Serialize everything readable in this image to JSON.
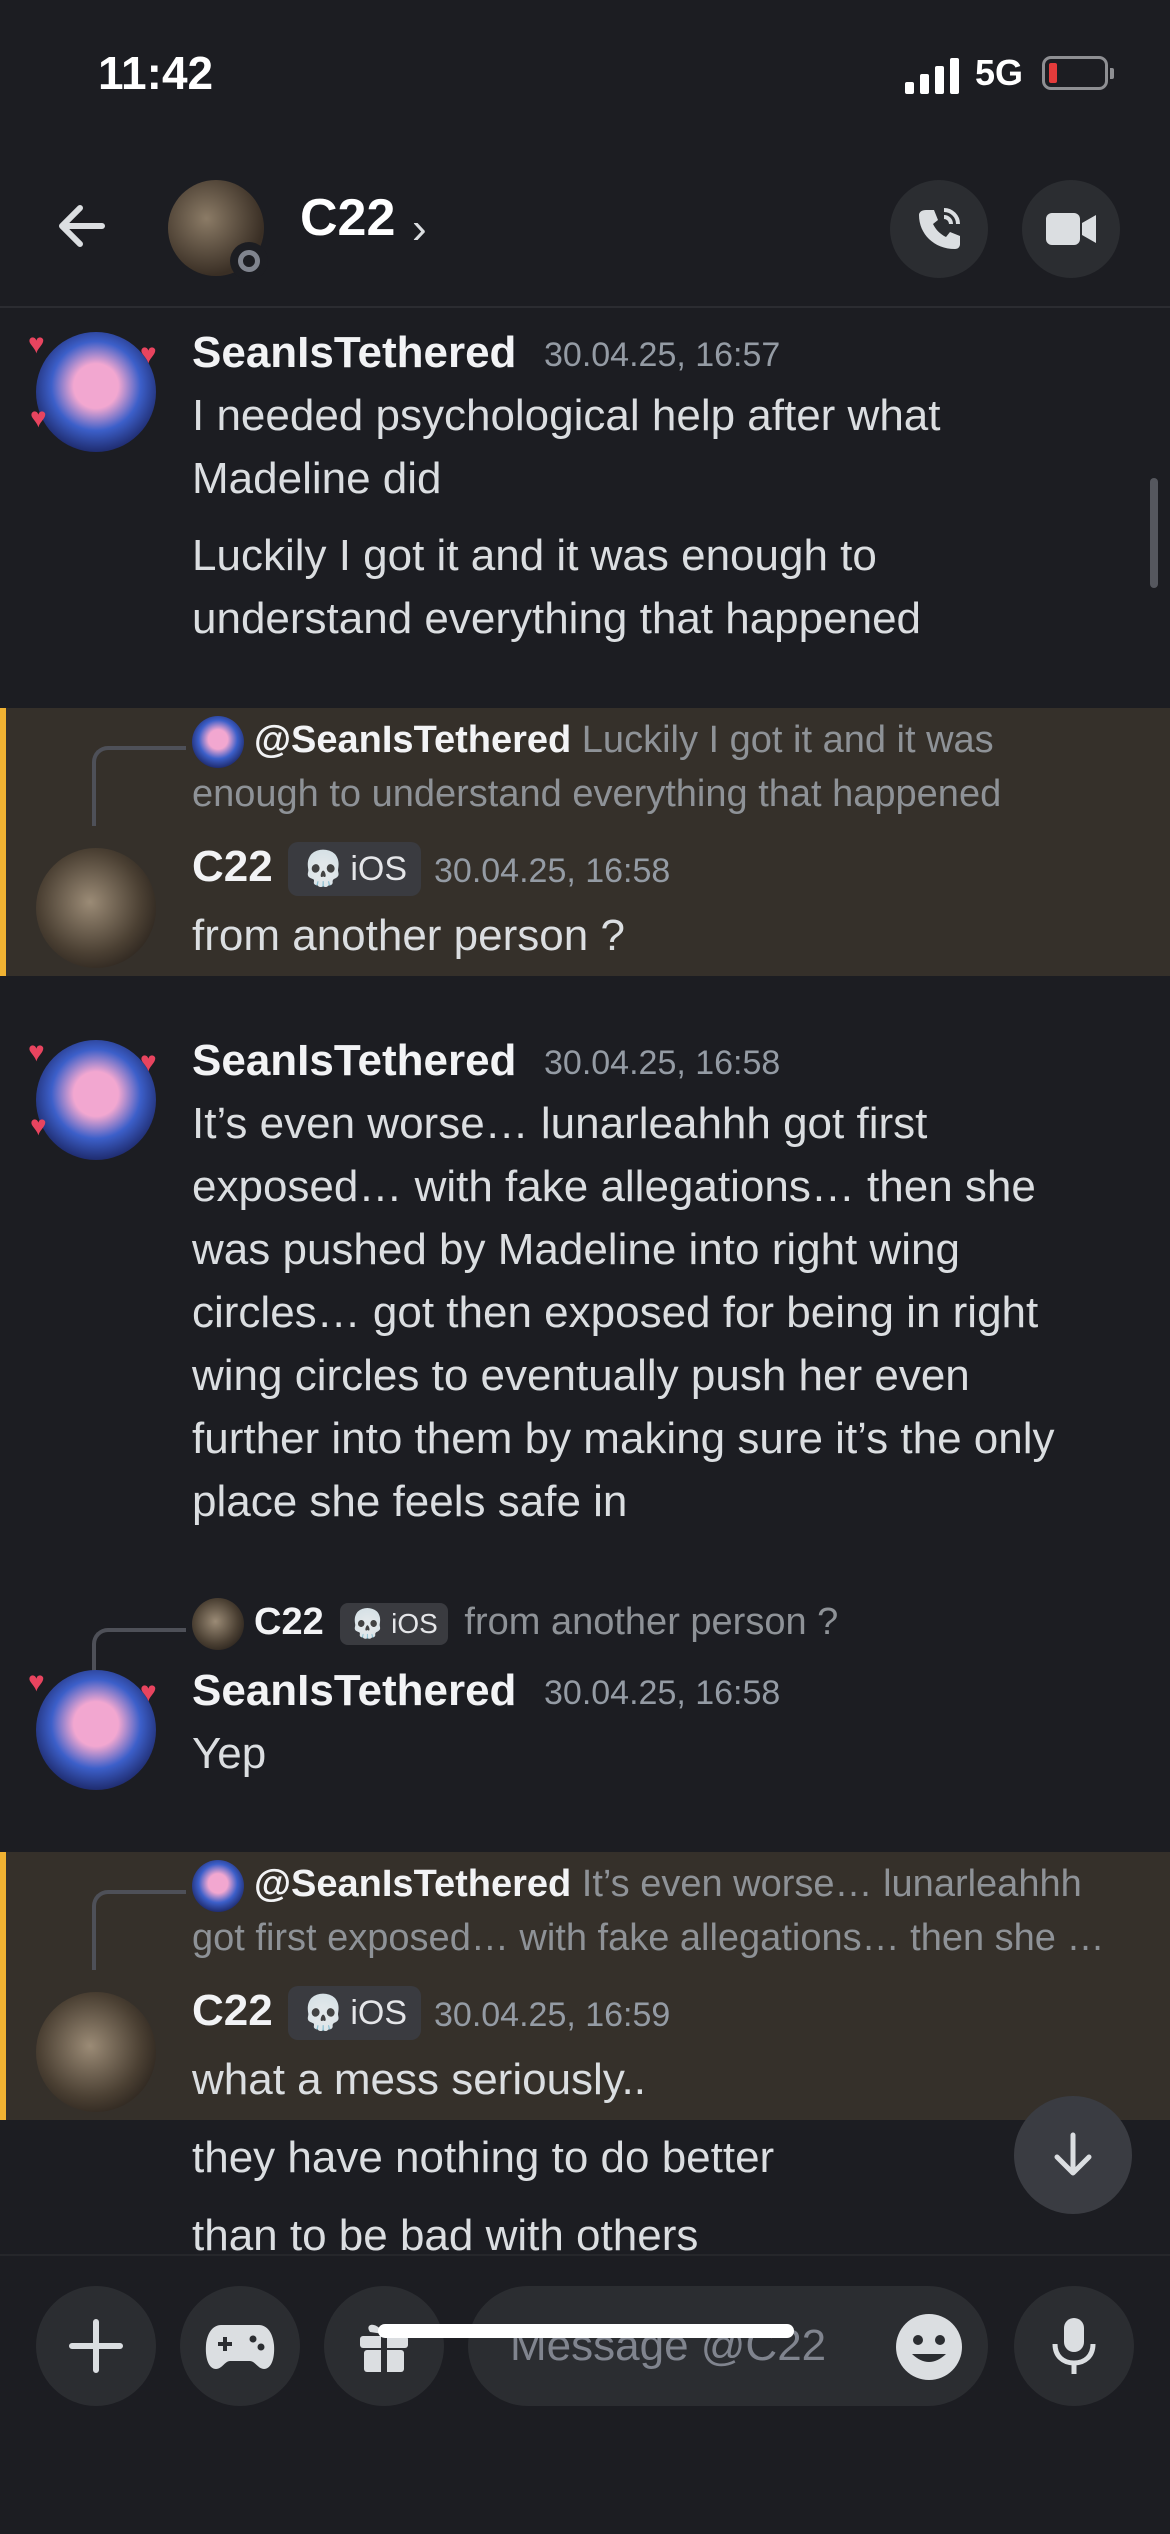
{
  "status_bar": {
    "time": "11:42",
    "network": "5G"
  },
  "header": {
    "channel_name": "C22",
    "chevron": "›"
  },
  "messages": [
    {
      "author": "SeanIsTethered",
      "timestamp": "30.04.25, 16:57",
      "lines": [
        "I needed psychological help after what",
        "Madeline did"
      ],
      "lines2": [
        "Luckily I got it and it was enough to",
        "understand everything that happened"
      ]
    },
    {
      "reply_author": "@SeanIsTethered",
      "reply_text_1": "Luckily I got it and it was",
      "reply_text_2": "enough to understand everything that happened",
      "author": "C22",
      "tag": "iOS",
      "timestamp": "30.04.25, 16:58",
      "text": "from another person ?"
    },
    {
      "author": "SeanIsTethered",
      "timestamp": "30.04.25, 16:58",
      "lines": [
        "It’s even worse… lunarleahhh got first",
        "exposed… with fake allegations… then she",
        "was pushed by Madeline into right wing",
        "circles… got then exposed for being in right",
        "wing circles to eventually push her even",
        "further into them by making sure it’s the only",
        "place she feels safe in"
      ]
    },
    {
      "reply_author": "C22",
      "reply_tag": "iOS",
      "reply_text": "from another person ?",
      "author": "SeanIsTethered",
      "timestamp": "30.04.25, 16:58",
      "text": "Yep"
    },
    {
      "reply_author": "@SeanIsTethered",
      "reply_text_1": "It’s even worse… lunarleahhh",
      "reply_text_2": "got first exposed… with fake allegations… then she …",
      "author": "C22",
      "tag": "iOS",
      "timestamp": "30.04.25, 16:59",
      "text": "what a mess seriously..",
      "text2": "they have nothing to do better",
      "text3": "than to be bad with others"
    }
  ],
  "composer": {
    "placeholder": "Message @C22"
  },
  "colors": {
    "highlight": "#f0b232",
    "background": "#1c1d22"
  }
}
